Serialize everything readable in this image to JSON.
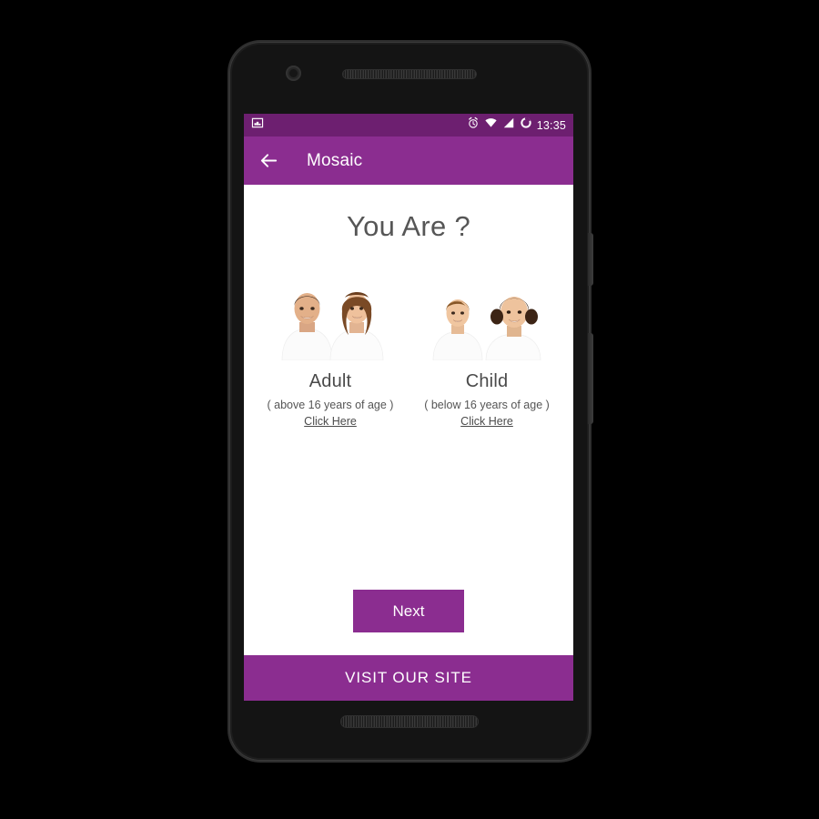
{
  "device": {
    "name": "android-phone-mockup",
    "camera_icon": "camera-icon",
    "speaker_top_icon": "earpiece-speaker",
    "speaker_bottom_icon": "loudspeaker",
    "power_button": "power-button",
    "volume_button": "volume-rocker"
  },
  "status_bar": {
    "left_icons": [
      "image-icon"
    ],
    "right_icons": [
      "alarm-icon",
      "wifi-icon",
      "signal-icon",
      "battery-icon"
    ],
    "time": "13:35",
    "background_color": "#6d1f70",
    "foreground_color": "#ffffff"
  },
  "app_bar": {
    "back_icon": "back-arrow-icon",
    "title": "Mosaic",
    "background_color": "#8b2d90",
    "foreground_color": "#ffffff"
  },
  "content": {
    "page_title": "You Are ?",
    "choices": [
      {
        "id": "adult",
        "photo_icon": "adult-couple-photo",
        "label": "Adult",
        "subtitle": "( above 16 years of age )",
        "link": "Click Here"
      },
      {
        "id": "child",
        "photo_icon": "children-photo",
        "label": "Child",
        "subtitle": "( below 16 years of age )",
        "link": "Click Here"
      }
    ],
    "next_button": "Next"
  },
  "bottom_bar": {
    "label": "VISIT OUR SITE",
    "background_color": "#8b2d90"
  },
  "theme": {
    "accent": "#8b2d90",
    "accent_dark": "#6d1f70",
    "text_primary": "#4a4a4a",
    "text_secondary": "#555555",
    "surface": "#ffffff"
  }
}
